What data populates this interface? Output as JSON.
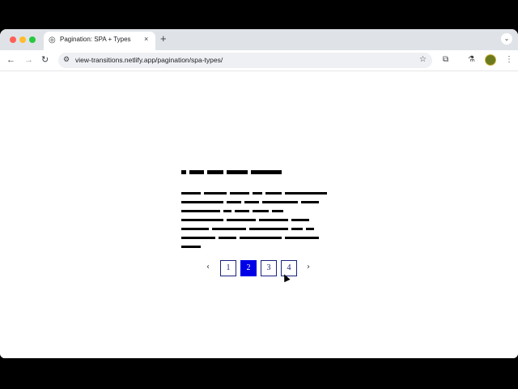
{
  "browser": {
    "tab_title": "Pagination: SPA + Types",
    "tab_close": "×",
    "new_tab": "+",
    "url": "view-transitions.netlify.app/pagination/spa-types/"
  },
  "icons": {
    "favicon": "globe-icon",
    "back": "arrow-left-icon",
    "forward": "arrow-right-icon",
    "reload": "reload-icon",
    "site_info": "tune-icon",
    "bookmark": "star-icon",
    "extensions": "puzzle-icon",
    "labs": "flask-icon",
    "menu": "more-vert-icon"
  },
  "pagination": {
    "prev": "‹",
    "next": "›",
    "pages": [
      "1",
      "2",
      "3",
      "4"
    ],
    "current": "2"
  },
  "colors": {
    "active_page": "#0000e6",
    "page_border": "#1a237e"
  }
}
